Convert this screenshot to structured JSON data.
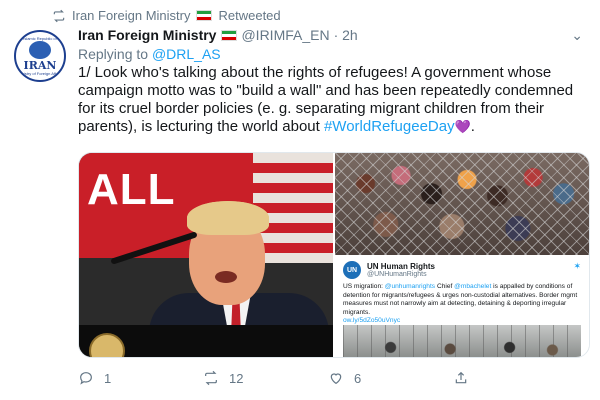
{
  "retweet": {
    "label": "Iran Foreign Ministry",
    "status": "Retweeted"
  },
  "avatar": {
    "line1": "Islamic Republic of",
    "line2": "IRAN",
    "line3": "Ministry of Foreign Affairs"
  },
  "tweet": {
    "author_name": "Iran Foreign Ministry",
    "handle": "@IRIMFA_EN",
    "time": "· 2h",
    "reply_prefix": "Replying to",
    "reply_handle": "@DRL_AS",
    "text": "1/ Look who's talking about the rights of refugees! A government whose campaign motto was to \"build a wall\" and has been repeatedly condemned for its cruel border policies (e. g. separating migrant children from their parents), is lecturing the world about",
    "hashtag": "#WorldRefugeeDay",
    "heart": "💜",
    "end": "."
  },
  "media": {
    "left_banner_text": "ALL",
    "embed": {
      "name": "UN Human Rights",
      "handle": "@UNHumanRights",
      "text_prefix": "US migration: ",
      "mention1": "@unhumanrights",
      "text_mid": " Chief ",
      "mention2": "@mbachelet",
      "text_body": " is appalled by conditions of detention for migrants/refugees & urges non-custodial alternatives. Border mgmt measures must not narrowly aim at detecting, detaining & deporting irregular migrants.",
      "link": "ow.ly/5dZo50uVnyc"
    }
  },
  "actions": {
    "reply_count": "1",
    "retweet_count": "12",
    "like_count": "6"
  },
  "colors": {
    "accent": "#1da1f2",
    "muted": "#657786",
    "text": "#14171a"
  },
  "icons": [
    "retweet-icon",
    "iran-flag-icon",
    "chevron-down-icon",
    "reply-icon",
    "like-icon",
    "share-icon",
    "twitter-bird-icon"
  ]
}
